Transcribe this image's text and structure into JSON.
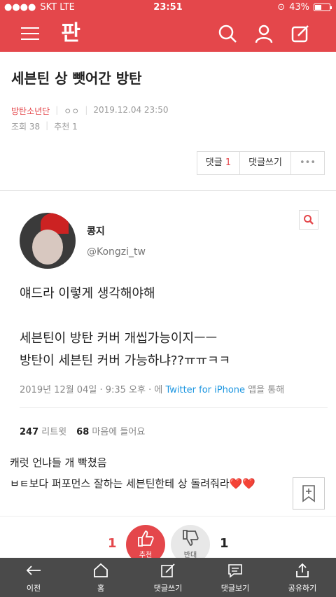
{
  "status": {
    "carrier": "SKT LTE",
    "time": "23:51",
    "battery": "43%",
    "battery_level": 0.43
  },
  "header": {
    "logo_text": "판"
  },
  "post": {
    "title": "세븐틴 상 뺏어간 방탄",
    "board": "방탄소년단",
    "author": "ㅇㅇ",
    "date": "2019.12.04 23:50",
    "views_label": "조회 38",
    "recommend_label": "추천 1"
  },
  "actions": {
    "comments_label": "댓글",
    "comments_count": "1",
    "write_comment": "댓글쓰기",
    "more": "•••"
  },
  "tweet": {
    "name": "콩지",
    "handle": "@Kongzi_tw",
    "text": "얘드라 이렇게 생각해야해\n\n세븐틴이 방탄 커버 개씹가능이지ㅡㅡ\n방탄이 세븐틴 커버 가능하냐??ㅠㅠㅋㅋ",
    "date_prefix": "2019년 12월 04일 · 9:35 오후 · 에 ",
    "source": "Twitter for iPhone",
    "date_suffix": " 앱을 통해",
    "retweets": "247",
    "retweets_label": "리트윗",
    "likes": "68",
    "likes_label": "마음에 들어요"
  },
  "body": {
    "line1": "캐럿 언냐들 개 빡쳤음",
    "line2": "ㅂㅌ보다 퍼포먼스 잘하는 세븐틴한테 상 돌려줘라",
    "hearts": "❤️❤️"
  },
  "vote": {
    "up_count": "1",
    "up_label": "추천",
    "down_label": "반대",
    "down_count": "1"
  },
  "bottom": {
    "back": "이전",
    "home": "홈",
    "write": "댓글쓰기",
    "view": "댓글보기",
    "share": "공유하기"
  },
  "colors": {
    "brand": "#e4474b",
    "bottom_bar": "#4a4a4a"
  }
}
